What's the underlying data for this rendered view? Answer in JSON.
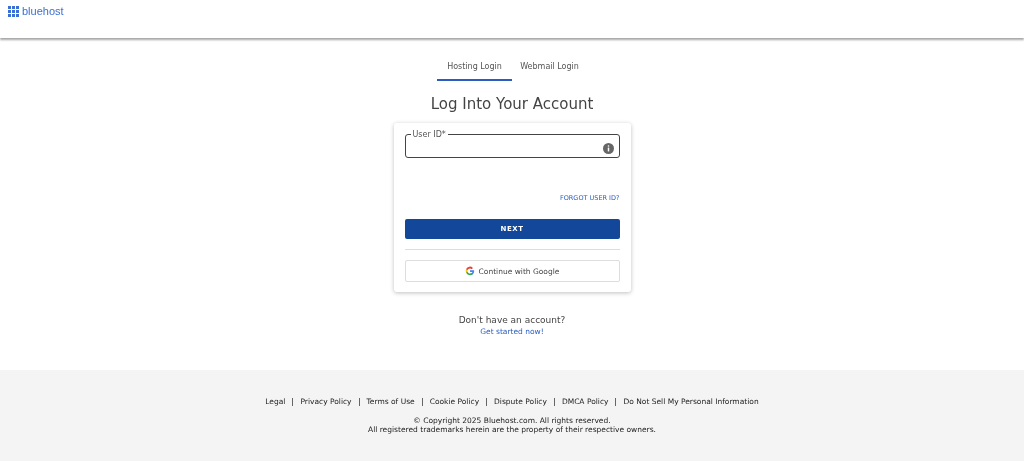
{
  "header": {
    "logo_text": "bluehost"
  },
  "tabs": [
    {
      "label": "Hosting Login",
      "selected": true
    },
    {
      "label": "Webmail Login",
      "selected": false
    }
  ],
  "title": "Log Into Your Account",
  "form": {
    "field_label": "User ID*",
    "forgot_link": "FORGOT USER ID?",
    "next_button": "NEXT",
    "google_button": "Continue with Google"
  },
  "signup": {
    "prompt": "Don't have an account?",
    "link": "Get started now!"
  },
  "footer": {
    "links": [
      "Legal",
      "Privacy Policy",
      "Terms of Use",
      "Cookie Policy",
      "Dispute Policy",
      "DMCA Policy",
      "Do Not Sell My Personal Information"
    ],
    "copyright": "© Copyright 2025 Bluehost.com. All rights reserved.",
    "trademark": "All registered trademarks herein are the property of their respective owners."
  }
}
